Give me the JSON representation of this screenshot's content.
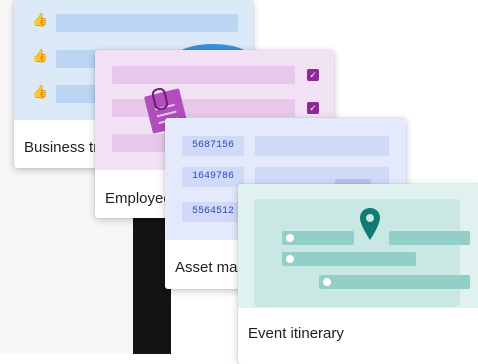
{
  "templates": [
    {
      "id": "business",
      "caption": "Business trip",
      "icon": "thumbs-up-icon"
    },
    {
      "id": "employee",
      "caption": "Employee onboarding",
      "icon": "clipboard-icon"
    },
    {
      "id": "asset",
      "caption": "Asset management",
      "icon": "id-number-icon",
      "numbers": [
        "5687156",
        "1649786",
        "5564512"
      ]
    },
    {
      "id": "event",
      "caption": "Event itinerary",
      "icon": "map-pin-icon"
    }
  ],
  "colors": {
    "business_bg": "#dbe9f8",
    "employee_bg": "#f2e1f4",
    "asset_bg": "#e4e9fb",
    "event_bg": "#e1f1ef",
    "pin": "#0f7b73"
  }
}
